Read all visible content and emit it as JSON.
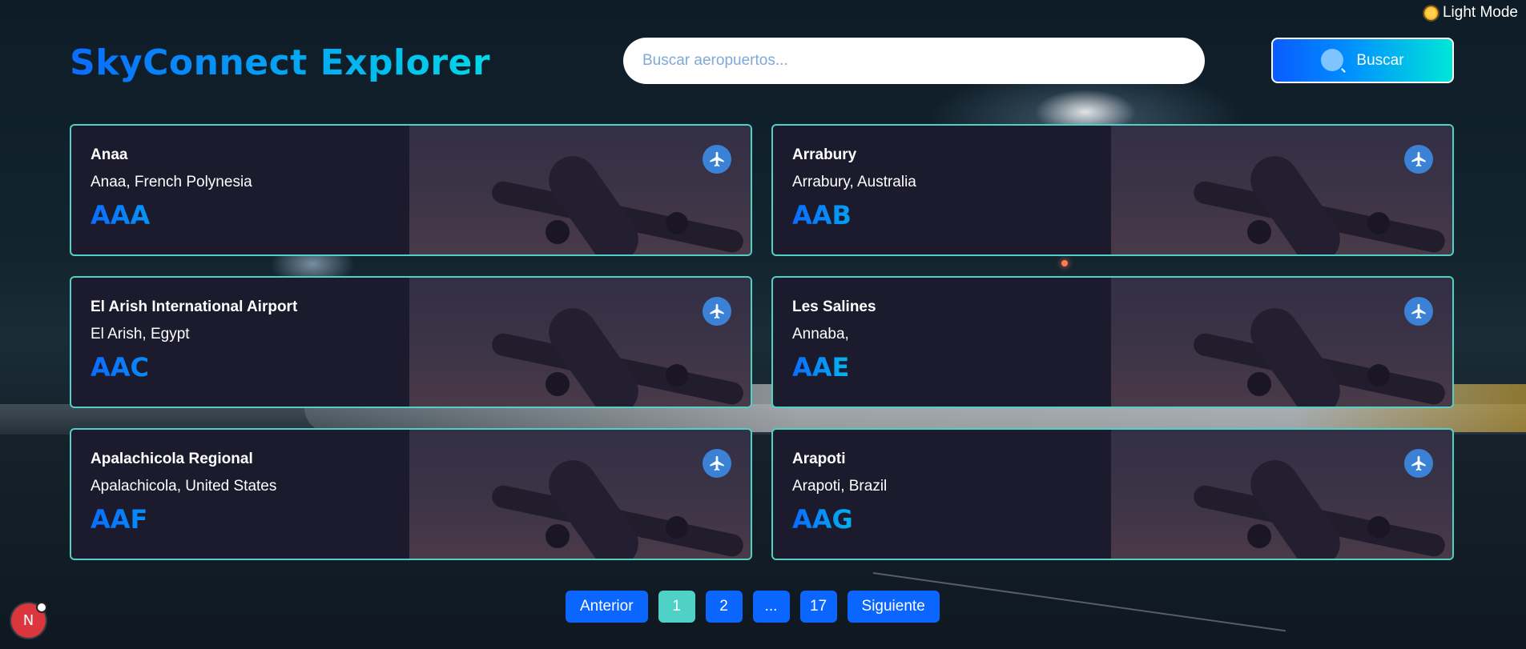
{
  "theme_toggle": {
    "label": "Light Mode",
    "icon": "sun-icon"
  },
  "header": {
    "title": "SkyConnect Explorer"
  },
  "search": {
    "placeholder": "Buscar aeropuertos...",
    "button_label": "Buscar",
    "icon": "search-icon"
  },
  "airports": [
    {
      "name": "Anaa",
      "location": "Anaa, French Polynesia",
      "code": "AAA"
    },
    {
      "name": "Arrabury",
      "location": "Arrabury, Australia",
      "code": "AAB"
    },
    {
      "name": "El Arish International Airport",
      "location": "El Arish, Egypt",
      "code": "AAC"
    },
    {
      "name": "Les Salines",
      "location": "Annaba,",
      "code": "AAE"
    },
    {
      "name": "Apalachicola Regional",
      "location": "Apalachicola, United States",
      "code": "AAF"
    },
    {
      "name": "Arapoti",
      "location": "Arapoti, Brazil",
      "code": "AAG"
    }
  ],
  "pagination": {
    "prev_label": "Anterior",
    "pages": [
      "1",
      "2",
      "...",
      "17"
    ],
    "current_page": "1",
    "next_label": "Siguiente"
  },
  "dev_badge": {
    "label": "N"
  },
  "colors": {
    "accent_border": "#4fd1c5",
    "button_blue": "#0a66ff",
    "gradient_start": "#0a6cff",
    "gradient_end": "#00d9e8",
    "card_background": "#1b1b2d"
  }
}
